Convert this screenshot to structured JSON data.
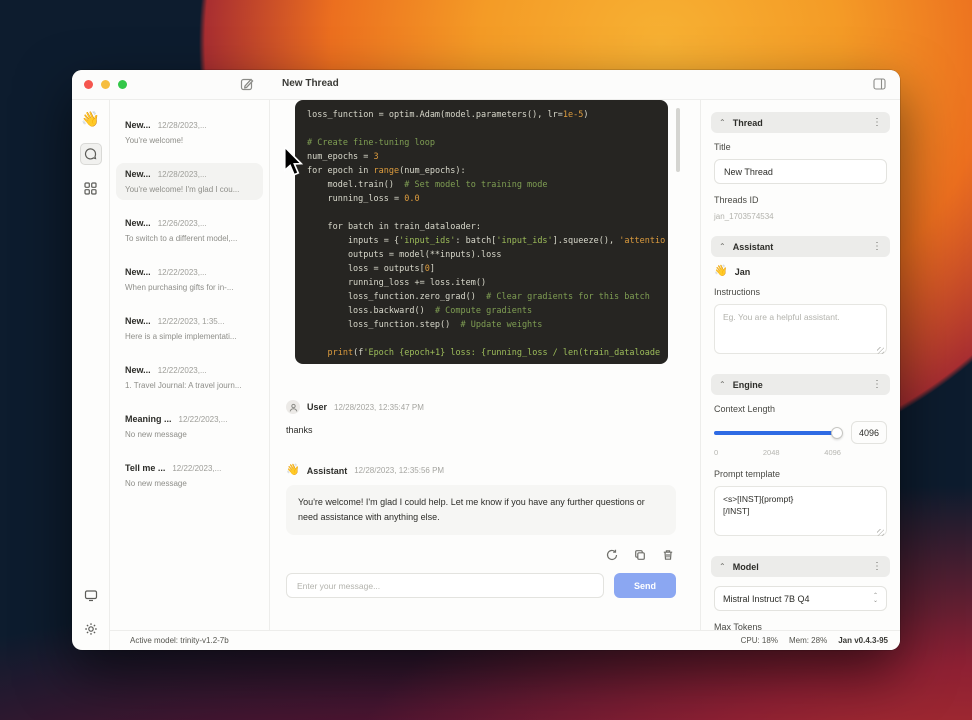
{
  "window": {
    "titlebar": {
      "title": "New Thread"
    },
    "icons": {
      "wave_emoji": "👋"
    },
    "threads": {
      "items": [
        {
          "title": "New...",
          "date": "12/28/2023,...",
          "preview": "You're welcome!",
          "active": false
        },
        {
          "title": "New...",
          "date": "12/28/2023,...",
          "preview": "You're welcome! I'm glad I cou...",
          "active": true
        },
        {
          "title": "New...",
          "date": "12/26/2023,...",
          "preview": "To switch to a different model,...",
          "active": false
        },
        {
          "title": "New...",
          "date": "12/22/2023,...",
          "preview": "When purchasing gifts for in-...",
          "active": false
        },
        {
          "title": "New...",
          "date": "12/22/2023, 1:35...",
          "preview": "Here is a simple implementati...",
          "active": false
        },
        {
          "title": "New...",
          "date": "12/22/2023,...",
          "preview": "1. Travel Journal: A travel journ...",
          "active": false
        },
        {
          "title": "Meaning ...",
          "date": "12/22/2023,...",
          "preview": "No new message",
          "active": false
        },
        {
          "title": "Tell me ...",
          "date": "12/22/2023,...",
          "preview": "No new message",
          "active": false
        }
      ]
    },
    "chat": {
      "code": {
        "lines": [
          [
            [
              "loss_function = optim.Adam(model.parameters(), lr=",
              "d"
            ],
            [
              "1e-5",
              "n"
            ],
            [
              ")",
              "d"
            ]
          ],
          [],
          [
            [
              "# Create fine-tuning loop",
              "c"
            ]
          ],
          [
            [
              "num_epochs = ",
              "d"
            ],
            [
              "3",
              "n"
            ]
          ],
          [
            [
              "for epoch in ",
              "d"
            ],
            [
              "range",
              "n"
            ],
            [
              "(num_epochs):",
              "d"
            ]
          ],
          [
            [
              "    model.train()  ",
              "d"
            ],
            [
              "# Set model to training mode",
              "c"
            ]
          ],
          [
            [
              "    running_loss = ",
              "d"
            ],
            [
              "0.0",
              "n"
            ]
          ],
          [],
          [
            [
              "    for batch in train_dataloader:",
              "d"
            ]
          ],
          [
            [
              "        inputs = {",
              "d"
            ],
            [
              "'input_ids'",
              "s"
            ],
            [
              ": batch[",
              "d"
            ],
            [
              "'input_ids'",
              "s"
            ],
            [
              "].squeeze(), ",
              "d"
            ],
            [
              "'attentio",
              "n"
            ]
          ],
          [
            [
              "        outputs = model(**inputs).loss",
              "d"
            ]
          ],
          [
            [
              "        loss = outputs[",
              "d"
            ],
            [
              "0",
              "n"
            ],
            [
              "]",
              "d"
            ]
          ],
          [
            [
              "        running_loss += loss.item()",
              "d"
            ]
          ],
          [
            [
              "        loss_function.zero_grad()  ",
              "d"
            ],
            [
              "# Clear gradients for this batch",
              "c"
            ]
          ],
          [
            [
              "        loss.backward()  ",
              "d"
            ],
            [
              "# Compute gradients",
              "c"
            ]
          ],
          [
            [
              "        loss_function.step()  ",
              "d"
            ],
            [
              "# Update weights",
              "c"
            ]
          ],
          [],
          [
            [
              "    ",
              "d"
            ],
            [
              "print",
              "n"
            ],
            [
              "(f",
              "d"
            ],
            [
              "'Epoch {epoch+1} loss: {running_loss / len(train_dataloade",
              "s"
            ]
          ]
        ]
      },
      "messages": [
        {
          "role": "User",
          "time": "12/28/2023, 12:35:47 PM",
          "text": "thanks"
        },
        {
          "role": "Assistant",
          "time": "12/28/2023, 12:35:56 PM",
          "text": "You're welcome! I'm glad I could help. Let me know if you have any further questions or need assistance with anything else."
        }
      ],
      "input": {
        "placeholder": "Enter your message...",
        "send_label": "Send"
      }
    },
    "panel": {
      "thread": {
        "header": "Thread",
        "title_label": "Title",
        "title_value": "New Thread",
        "id_label": "Threads ID",
        "id_value": "jan_1703574534"
      },
      "assistant": {
        "header": "Assistant",
        "name": "Jan",
        "instructions_label": "Instructions",
        "instructions_placeholder": "Eg. You are a helpful assistant."
      },
      "engine": {
        "header": "Engine",
        "context_label": "Context Length",
        "context_value": "4096",
        "ticks": [
          "0",
          "2048",
          "4096"
        ],
        "prompt_label": "Prompt template",
        "prompt_value": "<s>[INST]{prompt}\n[/INST]"
      },
      "model": {
        "header": "Model",
        "selected": "Mistral Instruct 7B Q4",
        "max_tokens_label": "Max Tokens"
      }
    },
    "statusbar": {
      "left": "Active model: trinity-v1.2-7b",
      "cpu": "CPU: 18%",
      "mem": "Mem: 28%",
      "version": "Jan v0.4.3-95"
    }
  },
  "colors": {
    "accent_blue": "#2f6be4",
    "send_button": "#8ba7f2"
  }
}
